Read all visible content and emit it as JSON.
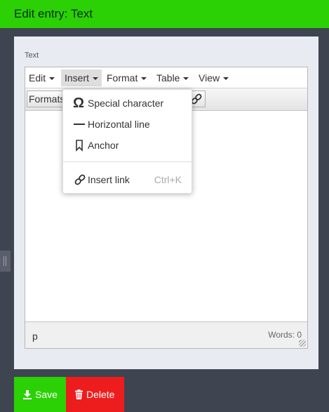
{
  "title": "Edit entry: Text",
  "field_label": "Text",
  "menubar": {
    "items": [
      {
        "label": "Edit"
      },
      {
        "label": "Insert"
      },
      {
        "label": "Format"
      },
      {
        "label": "Table"
      },
      {
        "label": "View"
      }
    ],
    "active": "Insert"
  },
  "toolbar": {
    "formats_label": "Formats"
  },
  "insert_menu": {
    "items": [
      {
        "label": "Special character",
        "icon": "omega-icon"
      },
      {
        "label": "Horizontal line",
        "icon": "horizontal-line-icon"
      },
      {
        "label": "Anchor",
        "icon": "bookmark-icon"
      },
      {
        "label": "Insert link",
        "icon": "link-icon",
        "shortcut": "Ctrl+K"
      }
    ]
  },
  "statusbar": {
    "path": "p",
    "word_count": "Words: 0"
  },
  "footer": {
    "save_label": "Save",
    "delete_label": "Delete"
  },
  "colors": {
    "header_green": "#2bd105",
    "delete_red": "#ee1d1d",
    "footer_bg": "#3f4451"
  }
}
